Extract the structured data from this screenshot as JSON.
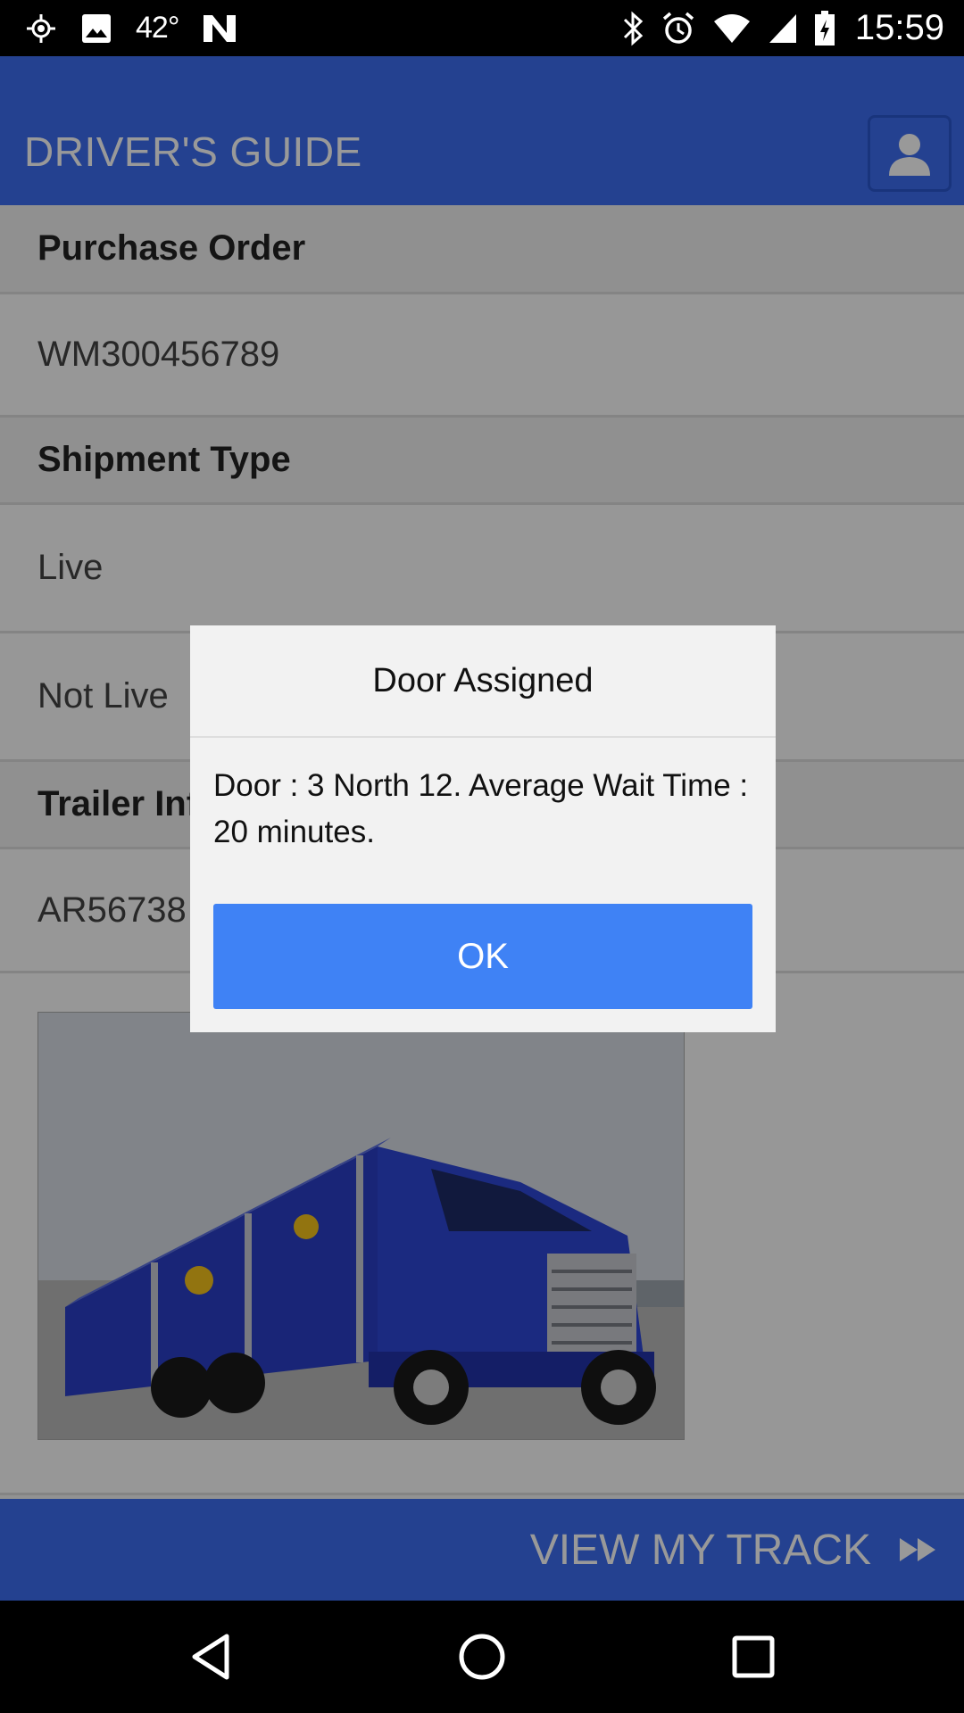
{
  "status_bar": {
    "temperature": "42°",
    "time": "15:59",
    "icons": [
      "location-icon",
      "image-icon",
      "n-app-icon",
      "bluetooth-icon",
      "alarm-icon",
      "wifi-icon",
      "signal-icon",
      "battery-charging-icon"
    ]
  },
  "app_bar": {
    "title": "DRIVER'S GUIDE",
    "profile_icon": "user-icon"
  },
  "content": {
    "rows": [
      {
        "label": "Purchase Order",
        "kind": "header"
      },
      {
        "label": "WM300456789",
        "kind": "value"
      },
      {
        "label": "Shipment Type",
        "kind": "header"
      },
      {
        "label": "Live",
        "kind": "value"
      },
      {
        "label": "Not Live",
        "kind": "value"
      },
      {
        "label": "Trailer Info",
        "kind": "header"
      },
      {
        "label": "AR56738",
        "kind": "value"
      }
    ],
    "image_description_icon": "truck-image"
  },
  "bottom_bar": {
    "label": "VIEW MY TRACK",
    "icon": "fast-forward-icon"
  },
  "dialog": {
    "title": "Door Assigned",
    "message": "Door : 3 North 12. Average Wait Time : 20 minutes.",
    "ok_label": "OK"
  },
  "nav_bar": {
    "icons": [
      "back-icon",
      "home-icon",
      "recents-icon"
    ]
  },
  "colors": {
    "primary": "#3d6df0",
    "dialog_button": "#3f82f5"
  }
}
